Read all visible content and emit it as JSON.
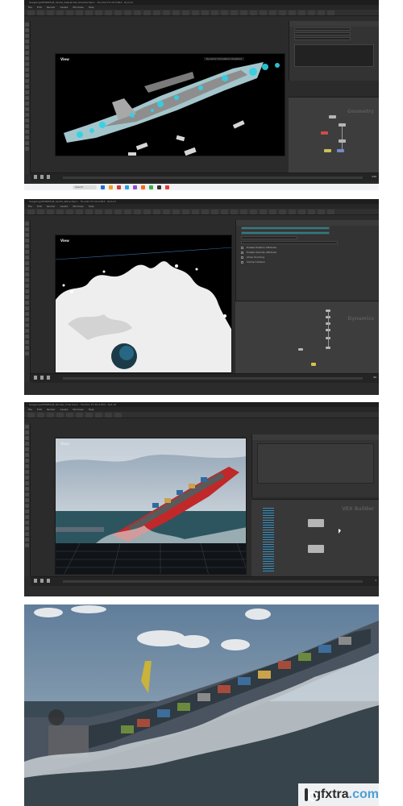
{
  "panels": [
    {
      "title": "Seagoing/UE98W5/J5_Sprite_Dispatchet_Shadow.hipnc - Houdini FX 20.0.653 - Py3.10",
      "menu": [
        "File",
        "Edit",
        "Render",
        "Assets",
        "Windows",
        "Help"
      ],
      "viewport_label": "View",
      "camera_label": "Dynamic Simulation Disabled",
      "network_watermark": "Geometry",
      "frame": "240",
      "taskbar_search": "Search"
    },
    {
      "title": "Seagoing/UE98W5/J5_Sprite_Wave.hipnc - Houdini FX 20.0.653 - Py3.10",
      "menu": [
        "File",
        "Edit",
        "Render",
        "Assets",
        "Windows",
        "Help"
      ],
      "viewport_label": "View",
      "network_watermark": "Dynamics",
      "param_rows": [
        "Enable Position Attribute",
        "Enable Velocity Attribute",
        "Allow Sourcing",
        "Clamp Collision"
      ],
      "frame": "96"
    },
    {
      "title": "Seagoing/UE98W5/J5_Render_Final.hipnc - Houdini FX 20.0.653 - Py3.10",
      "menu": [
        "File",
        "Edit",
        "Render",
        "Assets",
        "Windows",
        "Help"
      ],
      "viewport_label": "View",
      "network_watermark": "VEX Builder",
      "frame": "1"
    }
  ],
  "watermark": {
    "name": "gfxtra",
    "tld": ".com"
  },
  "colors": {
    "houdini_bg": "#2b2b2b",
    "foam_cyan": "#2ed3e6",
    "ship_red": "#c0282a",
    "sky": "#6d8aa6"
  }
}
